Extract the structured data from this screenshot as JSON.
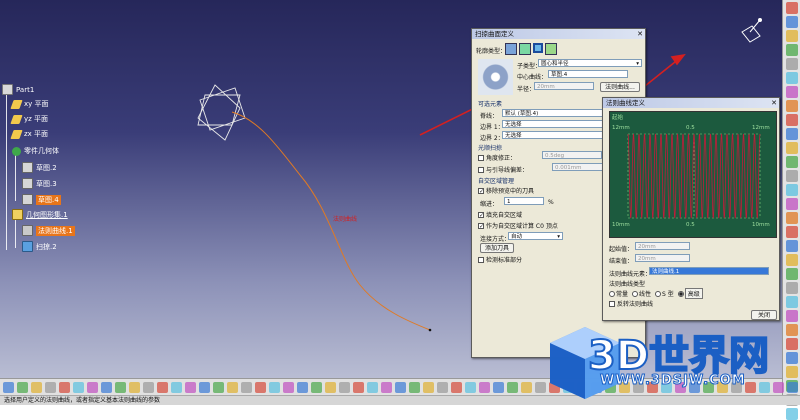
{
  "status_bar": {
    "text": "选择用户定义的法则曲线，或者指定义基本法则曲线的参数"
  },
  "tree": {
    "root": "Part1",
    "planes": [
      "xy 平面",
      "yz 平面",
      "zx 平面"
    ],
    "body": "零件几何体",
    "sketches": [
      "草图.2",
      "草图.3",
      "草图.4"
    ],
    "geoset": "几何图形集.1",
    "law_curve": "法则曲线.1",
    "sweep": "扫掠.2"
  },
  "viewport": {
    "curve_label": "法则曲线"
  },
  "sweep_dialog": {
    "title": "扫掠曲面定义",
    "profile_type_label": "轮廓类型：",
    "subtype_label": "子类型：",
    "subtype_value": "圆心和半径",
    "center_curve_label": "中心曲线：",
    "center_curve_value": "草图.4",
    "radius_label": "半径：",
    "radius_value": "20mm",
    "law_button": "法则曲线...",
    "optional_elements_label": "可选元素",
    "spine_label": "脊线：",
    "spine_value": "默认 (草图.4)",
    "boundary1_label": "边界 1：",
    "boundary1_value": "无选择",
    "boundary2_label": "边界 2：",
    "boundary2_value": "无选择",
    "smooth_label": "光顺扫掠",
    "angle_correction_label": "角度修正：",
    "angle_correction_value": "0.5deg",
    "deviation_label": "与引导线偏差：",
    "deviation_value": "0.001mm",
    "self_intersect_label": "自交区域管理",
    "remove_tools_label": "移除预览中的刀具",
    "overlap_label": "缩进：",
    "overlap_value": "1",
    "overlap_unit": "%",
    "fill_label": "填充自交区域",
    "c0_label": "作为自交区域计算 C0 顶点",
    "fill_method_label": "连接方式：",
    "fill_method_value": "自动",
    "add_tool_button": "添加刀具",
    "canonical_label": "检测标准部分"
  },
  "law_dialog": {
    "title": "法则曲线定义",
    "chart_top_left": "12mm",
    "chart_top_mid": "0.5",
    "chart_top_right": "12mm",
    "chart_bottom_left": "10mm",
    "chart_bottom_mid": "0.5",
    "chart_bottom_right": "10mm",
    "chart_corner_tl": "起始",
    "start_value_label": "起始值：",
    "start_value": "20mm",
    "end_value_label": "结束值：",
    "end_value": "20mm",
    "law_element_label": "法则曲线元素：",
    "law_element_value": "法则曲线.1",
    "law_type_label": "法则曲线类型",
    "law_types": [
      "常量",
      "线性",
      "S 型",
      "高级"
    ],
    "law_type_selected": "高级",
    "invert_label": "反转法则曲线",
    "close_button": "关闭"
  },
  "watermark": {
    "text": "3D世界网",
    "url": "WWW.3DSJW.COM"
  },
  "colors": {
    "viewport_top": "#26275a",
    "dialog_bg": "#ece9d8",
    "selection_orange": "#e8751a",
    "chart_bg": "#1c5a3e",
    "chart_wave": "#c21b3a",
    "arrow_red": "#d42020",
    "watermark_blue": "#1b5fc4"
  },
  "chart_data": {
    "type": "line",
    "description_series": "law",
    "cycles": 24,
    "ylim": [
      10,
      12
    ],
    "xlim": [
      0,
      1
    ]
  }
}
